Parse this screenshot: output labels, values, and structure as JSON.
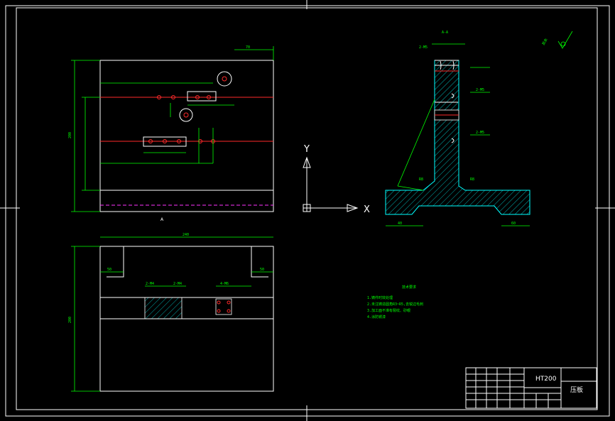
{
  "section_label": "A-A",
  "view_marker": "A",
  "material": "HT200",
  "part_name": "压板",
  "ucs": {
    "x_label": "X",
    "y_label": "Y"
  },
  "dims": {
    "overall_width": "240",
    "top_offset": "70",
    "height_left": "200",
    "lower_height": "200",
    "side_left": "50",
    "side_right": "50",
    "tap_left": "2-M4",
    "tap_right": "2-M4",
    "hole_label": "4-M6",
    "section_r1": "R8",
    "section_r2": "R8",
    "section_base": "40",
    "section_base2": "60",
    "section_tap1": "2-M5",
    "section_tap2": "2-M5",
    "section_tap3": "2-M5"
  },
  "notes": {
    "title": "技术要求",
    "lines": [
      "1.铸件时效处理",
      "2.未注铸造圆角R3~R5,去锐边毛刺",
      "3.加工面不准有裂纹、砂眼",
      "4.涂防锈漆"
    ]
  },
  "roughness_note": "其余"
}
